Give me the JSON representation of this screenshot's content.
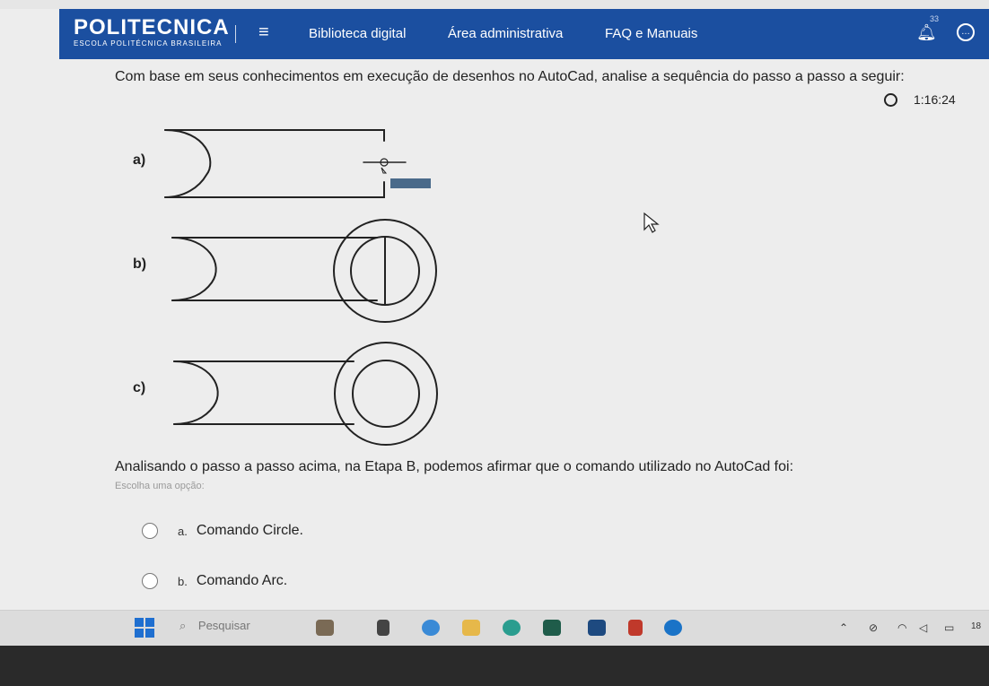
{
  "header": {
    "logo_main": "POLITECNICA",
    "logo_sub": "ESCOLA POLITÉCNICA BRASILEIRA",
    "menu_icon": "≡",
    "nav": [
      "Biblioteca digital",
      "Área administrativa",
      "FAQ e Manuais"
    ],
    "notification_count": "33"
  },
  "question": {
    "text": "Com base em seus conhecimentos em execução de desenhos no AutoCad, analise a sequência do passo a passo a seguir:",
    "timer": "1:16:24",
    "figure_labels": [
      "a)",
      "b)",
      "c)"
    ],
    "prompt": "Analisando o passo a passo acima, na Etapa B, podemos afirmar que o comando utilizado no AutoCad foi:",
    "select_hint": "Escolha uma opção:",
    "options": [
      {
        "letter": "a.",
        "label": "Comando Circle."
      },
      {
        "letter": "b.",
        "label": "Comando Arc."
      }
    ]
  },
  "taskbar": {
    "search_label": "Pesquisar",
    "clock": "18"
  },
  "colors": {
    "header_bg": "#1b4fa0",
    "page_bg": "#ededed"
  }
}
